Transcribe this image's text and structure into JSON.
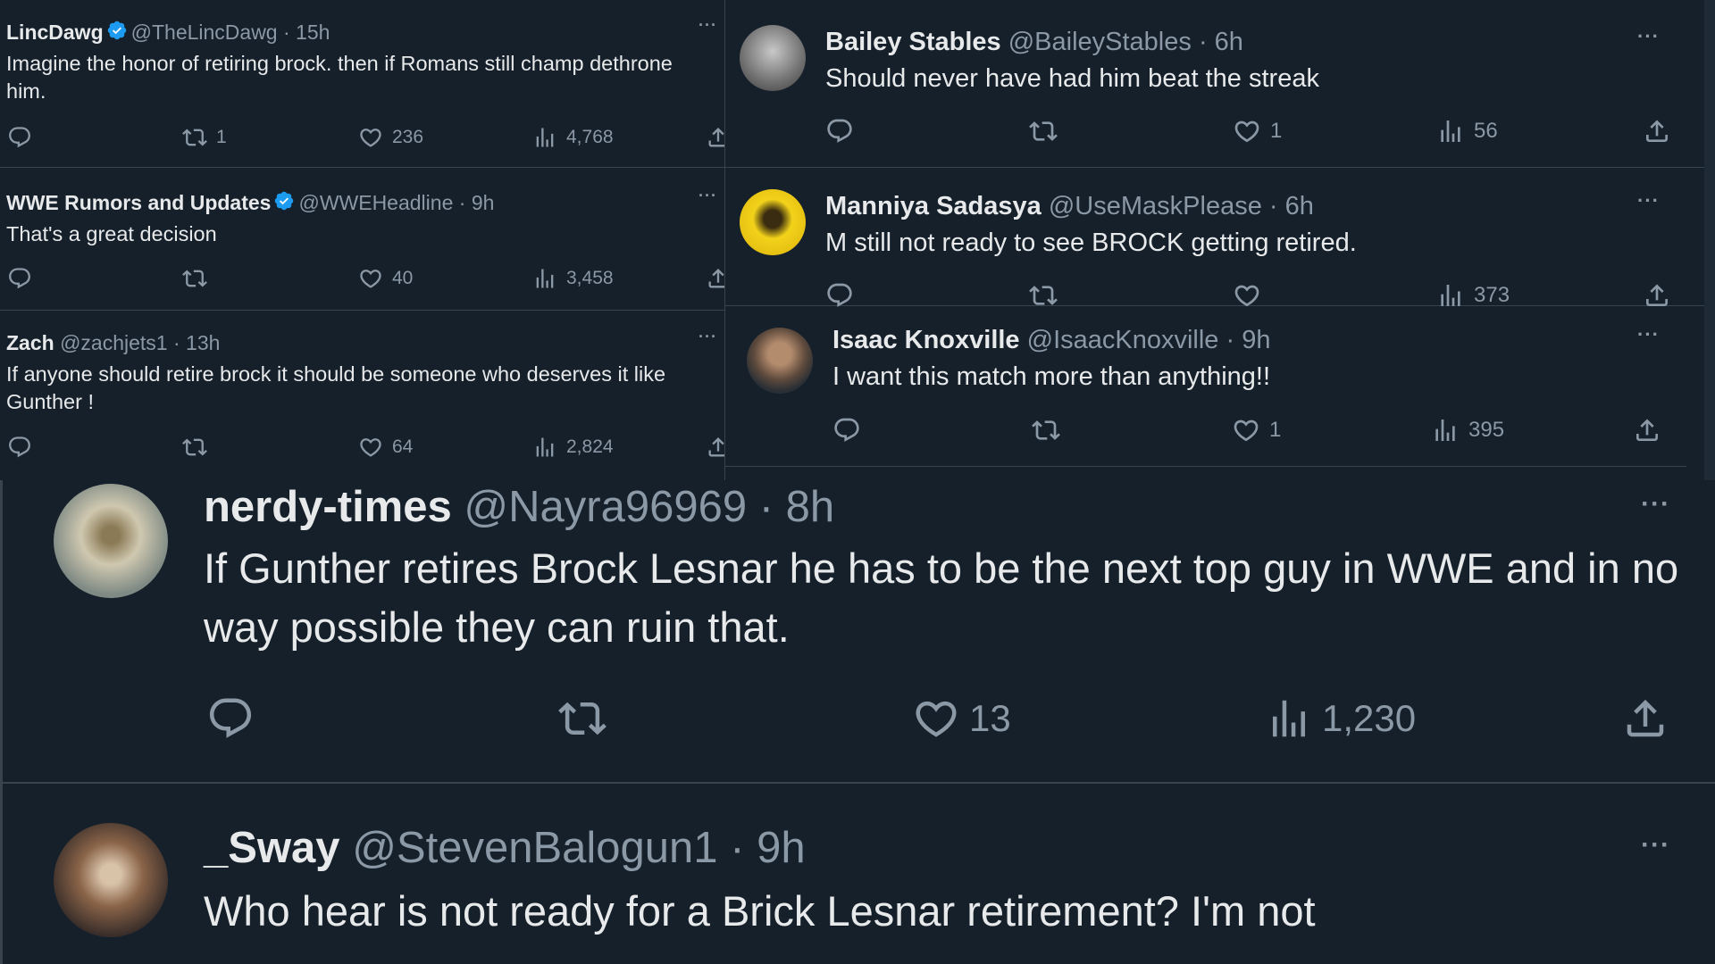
{
  "colors": {
    "background": "#15202b",
    "divider": "#38444d",
    "text": "#e7e9ea",
    "muted": "#8b98a5",
    "verified": "#1d9bf0"
  },
  "icons": {
    "reply": "reply-icon",
    "retweet": "retweet-icon",
    "like": "heart-icon",
    "views": "views-icon",
    "share": "share-icon",
    "more": "more-icon",
    "verified": "verified-badge-icon"
  },
  "tweets": [
    {
      "name": "LincDawg",
      "handle": "@TheLincDawg",
      "time": "· 15h",
      "verified": true,
      "text": "Imagine the honor of retiring brock.  then if Romans still champ dethrone him.",
      "retweets": "1",
      "likes": "236",
      "views": "4,768"
    },
    {
      "name": "WWE Rumors and Updates",
      "handle": "@WWEHeadline",
      "time": "· 9h",
      "verified": true,
      "text": "That's a great decision",
      "retweets": "",
      "likes": "40",
      "views": "3,458"
    },
    {
      "name": "Zach",
      "handle": "@zachjets1",
      "time": "· 13h",
      "verified": false,
      "text": "If anyone should retire brock it should be someone who deserves it like Gunther !",
      "retweets": "",
      "likes": "64",
      "views": "2,824"
    },
    {
      "name": "Bailey Stables",
      "handle": "@BaileyStables",
      "time": "· 6h",
      "verified": false,
      "text": "Should never have had him beat the streak",
      "retweets": "",
      "likes": "1",
      "views": "56"
    },
    {
      "name": "Manniya Sadasya",
      "handle": "@UseMaskPlease",
      "time": "· 6h",
      "verified": false,
      "text": "M still not ready to see BROCK getting retired.",
      "retweets": "",
      "likes": "",
      "views": "373"
    },
    {
      "name": "Isaac Knoxville",
      "handle": "@IsaacKnoxville",
      "time": "· 9h",
      "verified": false,
      "text": "I want this match more than anything!!",
      "retweets": "",
      "likes": "1",
      "views": "395"
    },
    {
      "name": "nerdy-times",
      "handle": "@Nayra96969",
      "time": "· 8h",
      "verified": false,
      "text": "If Gunther retires Brock Lesnar he has to be the next top guy in WWE and in no way possible they can ruin that.",
      "retweets": "",
      "likes": "13",
      "views": "1,230"
    },
    {
      "name": "_Sway",
      "handle": "@StevenBalogun1",
      "time": "· 9h",
      "verified": false,
      "text": "Who hear is not ready for a Brick Lesnar retirement? I'm not"
    }
  ]
}
